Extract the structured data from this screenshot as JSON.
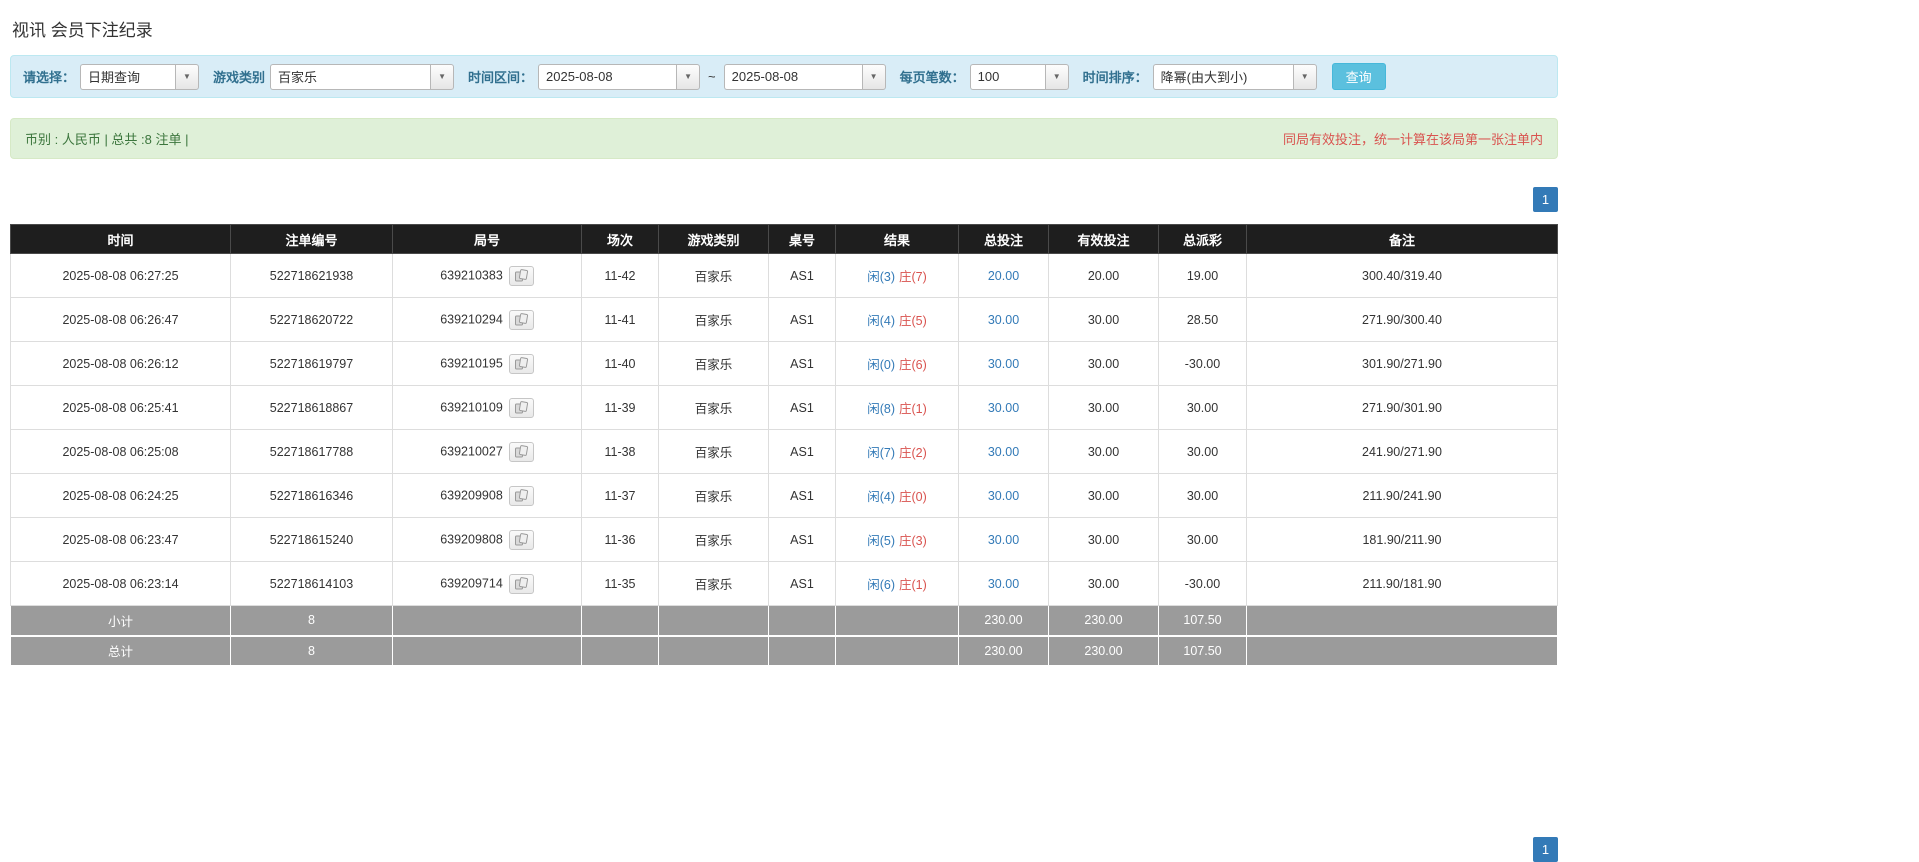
{
  "page": {
    "title": "视讯 会员下注纪录"
  },
  "filters": {
    "select_label": "请选择：",
    "select_value": "日期查询",
    "game_type_label": "游戏类别",
    "game_type_value": "百家乐",
    "date_range_label": "时间区间：",
    "date_from": "2025-08-08",
    "tilde": "~",
    "date_to": "2025-08-08",
    "page_size_label": "每页笔数：",
    "page_size_value": "100",
    "sort_label": "时间排序：",
    "sort_value": "降幂(由大到小)",
    "search_button": "查询"
  },
  "summary": {
    "left": "币别 : 人民币 | 总共 :8 注单 |",
    "right": "同局有效投注，统一计算在该局第一张注单内"
  },
  "pagination": {
    "page": "1"
  },
  "table": {
    "headers": [
      "时间",
      "注单编号",
      "局号",
      "场次",
      "游戏类别",
      "桌号",
      "结果",
      "总投注",
      "有效投注",
      "总派彩",
      "备注"
    ],
    "rows": [
      {
        "time": "2025-08-08 06:27:25",
        "bet_id": "522718621938",
        "round": "639210383",
        "session": "11-42",
        "game": "百家乐",
        "table_no": "AS1",
        "result_player": "闲(3)",
        "result_banker": "庄(7)",
        "total_bet": "20.00",
        "valid_bet": "20.00",
        "payout": "19.00",
        "remark": "300.40/319.40"
      },
      {
        "time": "2025-08-08 06:26:47",
        "bet_id": "522718620722",
        "round": "639210294",
        "session": "11-41",
        "game": "百家乐",
        "table_no": "AS1",
        "result_player": "闲(4)",
        "result_banker": "庄(5)",
        "total_bet": "30.00",
        "valid_bet": "30.00",
        "payout": "28.50",
        "remark": "271.90/300.40"
      },
      {
        "time": "2025-08-08 06:26:12",
        "bet_id": "522718619797",
        "round": "639210195",
        "session": "11-40",
        "game": "百家乐",
        "table_no": "AS1",
        "result_player": "闲(0)",
        "result_banker": "庄(6)",
        "total_bet": "30.00",
        "valid_bet": "30.00",
        "payout": "-30.00",
        "remark": "301.90/271.90"
      },
      {
        "time": "2025-08-08 06:25:41",
        "bet_id": "522718618867",
        "round": "639210109",
        "session": "11-39",
        "game": "百家乐",
        "table_no": "AS1",
        "result_player": "闲(8)",
        "result_banker": "庄(1)",
        "total_bet": "30.00",
        "valid_bet": "30.00",
        "payout": "30.00",
        "remark": "271.90/301.90"
      },
      {
        "time": "2025-08-08 06:25:08",
        "bet_id": "522718617788",
        "round": "639210027",
        "session": "11-38",
        "game": "百家乐",
        "table_no": "AS1",
        "result_player": "闲(7)",
        "result_banker": "庄(2)",
        "total_bet": "30.00",
        "valid_bet": "30.00",
        "payout": "30.00",
        "remark": "241.90/271.90"
      },
      {
        "time": "2025-08-08 06:24:25",
        "bet_id": "522718616346",
        "round": "639209908",
        "session": "11-37",
        "game": "百家乐",
        "table_no": "AS1",
        "result_player": "闲(4)",
        "result_banker": "庄(0)",
        "total_bet": "30.00",
        "valid_bet": "30.00",
        "payout": "30.00",
        "remark": "211.90/241.90"
      },
      {
        "time": "2025-08-08 06:23:47",
        "bet_id": "522718615240",
        "round": "639209808",
        "session": "11-36",
        "game": "百家乐",
        "table_no": "AS1",
        "result_player": "闲(5)",
        "result_banker": "庄(3)",
        "total_bet": "30.00",
        "valid_bet": "30.00",
        "payout": "30.00",
        "remark": "181.90/211.90"
      },
      {
        "time": "2025-08-08 06:23:14",
        "bet_id": "522718614103",
        "round": "639209714",
        "session": "11-35",
        "game": "百家乐",
        "table_no": "AS1",
        "result_player": "闲(6)",
        "result_banker": "庄(1)",
        "total_bet": "30.00",
        "valid_bet": "30.00",
        "payout": "-30.00",
        "remark": "211.90/181.90"
      }
    ],
    "subtotal": {
      "label": "小计",
      "count": "8",
      "total_bet": "230.00",
      "valid_bet": "230.00",
      "payout": "107.50"
    },
    "total": {
      "label": "总计",
      "count": "8",
      "total_bet": "230.00",
      "valid_bet": "230.00",
      "payout": "107.50"
    }
  },
  "colors": {
    "filter_bar_bg": "#d9edf7",
    "filter_label": "#31708f",
    "summary_bar_bg": "#dff0d8",
    "summary_text": "#3c763d",
    "warning_text": "#d9534f",
    "search_button": "#5bc0de",
    "pagination_active": "#337ab7",
    "table_header_bg": "#1e1e1e",
    "footer_row_bg": "#9b9b9b",
    "player_result": "#337ab7",
    "banker_result": "#d9534f",
    "negative_payout": "#d9534f",
    "bet_link": "#337ab7"
  }
}
